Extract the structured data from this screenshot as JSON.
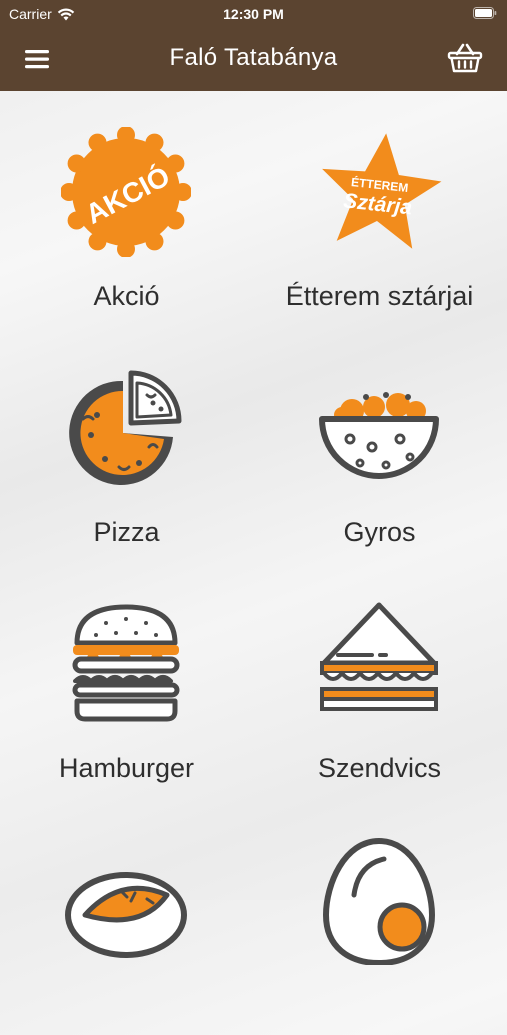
{
  "status_bar": {
    "carrier": "Carrier",
    "time": "12:30 PM"
  },
  "header": {
    "title": "Faló Tatabánya"
  },
  "categories": [
    {
      "label": "Akció",
      "icon": "akcio-badge-icon",
      "badge_text": "AKCIÓ"
    },
    {
      "label": "Étterem sztárjai",
      "icon": "star-badge-icon",
      "badge_line1": "ÉTTEREM",
      "badge_line2": "Sztárja"
    },
    {
      "label": "Pizza",
      "icon": "pizza-icon"
    },
    {
      "label": "Gyros",
      "icon": "gyros-bowl-icon"
    },
    {
      "label": "Hamburger",
      "icon": "hamburger-icon"
    },
    {
      "label": "Szendvics",
      "icon": "sandwich-icon"
    },
    {
      "label": "",
      "icon": "pastry-icon"
    },
    {
      "label": "",
      "icon": "egg-icon"
    }
  ],
  "colors": {
    "brand_brown": "#5b4430",
    "accent_orange": "#f28c1c",
    "icon_gray": "#4a4a4a"
  }
}
